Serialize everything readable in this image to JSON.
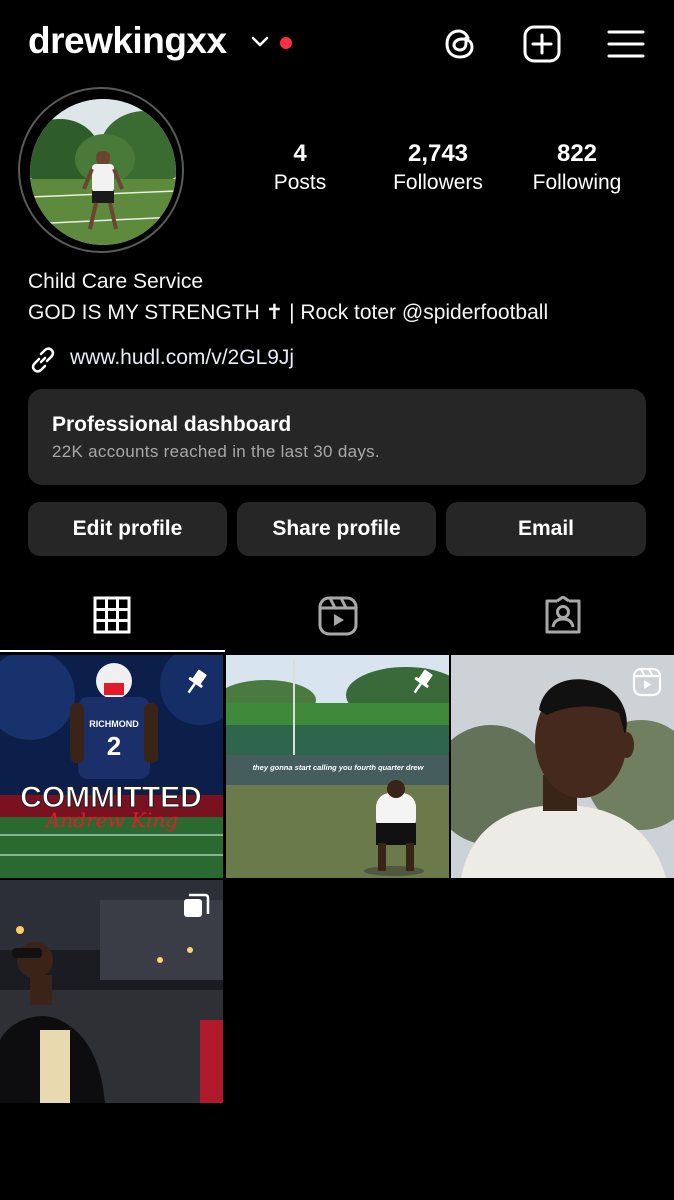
{
  "header": {
    "username": "drewkingxx",
    "icons": [
      "chevron-down-icon",
      "notification-dot",
      "threads-icon",
      "new-post-icon",
      "menu-icon"
    ],
    "accent_red": "#ff3040"
  },
  "profile": {
    "stats": [
      {
        "value": "4",
        "label": "Posts"
      },
      {
        "value": "2,743",
        "label": "Followers"
      },
      {
        "value": "822",
        "label": "Following"
      }
    ],
    "category": "Child Care Service",
    "bio": "GOD IS MY STRENGTH ✝ | Rock toter @spiderfootball",
    "link": "www.hudl.com/v/2GL9Jj"
  },
  "dashboard": {
    "title": "Professional dashboard",
    "subtitle": "22K accounts reached in the last 30 days."
  },
  "buttons": {
    "edit": "Edit profile",
    "share": "Share profile",
    "email": "Email"
  },
  "tabs": [
    "grid-icon",
    "reels-icon",
    "tagged-icon"
  ],
  "posts": {
    "post1": {
      "badge": "pin-icon",
      "overlay_text": "COMMITTED",
      "script_text": "Andrew King",
      "jersey_text": "RICHMOND",
      "jersey_number": "2"
    },
    "post2": {
      "badge": "pin-icon",
      "caption": "they gonna start calling you fourth quarter drew"
    },
    "post3": {
      "badge": "reel-icon"
    },
    "post4": {
      "badge": "carousel-icon"
    }
  }
}
